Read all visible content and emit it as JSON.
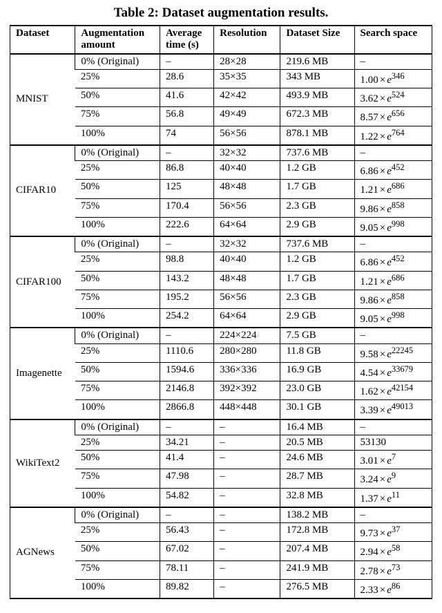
{
  "caption": "Table 2: Dataset augmentation results.",
  "columns": [
    "Dataset",
    "Augmentation amount",
    "Average time (s)",
    "Resolution",
    "Dataset Size",
    "Search space"
  ],
  "header_lines": {
    "col1": [
      "Augmentation",
      "amount"
    ],
    "col2": [
      "Average",
      "time (s)"
    ]
  },
  "groups": [
    {
      "name": "MNIST",
      "rows": [
        {
          "aug": "0% (Original)",
          "time": "–",
          "res": "28×28",
          "size": "219.6 MB",
          "search": {
            "text": "–"
          }
        },
        {
          "aug": "25%",
          "time": "28.6",
          "res": "35×35",
          "size": "343 MB",
          "search": {
            "coef": "1.00",
            "exp": "346"
          }
        },
        {
          "aug": "50%",
          "time": "41.6",
          "res": "42×42",
          "size": "493.9 MB",
          "search": {
            "coef": "3.62",
            "exp": "524"
          }
        },
        {
          "aug": "75%",
          "time": "56.8",
          "res": "49×49",
          "size": "672.3 MB",
          "search": {
            "coef": "8.57",
            "exp": "656"
          }
        },
        {
          "aug": "100%",
          "time": "74",
          "res": "56×56",
          "size": "878.1 MB",
          "search": {
            "coef": "1.22",
            "exp": "764"
          }
        }
      ]
    },
    {
      "name": "CIFAR10",
      "rows": [
        {
          "aug": "0% (Original)",
          "time": "–",
          "res": "32×32",
          "size": "737.6 MB",
          "search": {
            "text": "–"
          }
        },
        {
          "aug": "25%",
          "time": "86.8",
          "res": "40×40",
          "size": "1.2 GB",
          "search": {
            "coef": "6.86",
            "exp": "452"
          }
        },
        {
          "aug": "50%",
          "time": "125",
          "res": "48×48",
          "size": "1.7 GB",
          "search": {
            "coef": "1.21",
            "exp": "686"
          }
        },
        {
          "aug": "75%",
          "time": "170.4",
          "res": "56×56",
          "size": "2.3 GB",
          "search": {
            "coef": "9.86",
            "exp": "858"
          }
        },
        {
          "aug": "100%",
          "time": "222.6",
          "res": "64×64",
          "size": "2.9 GB",
          "search": {
            "coef": "9.05",
            "exp": "998"
          }
        }
      ]
    },
    {
      "name": "CIFAR100",
      "rows": [
        {
          "aug": "0% (Original)",
          "time": "–",
          "res": "32×32",
          "size": "737.6 MB",
          "search": {
            "text": "–"
          }
        },
        {
          "aug": "25%",
          "time": "98.8",
          "res": "40×40",
          "size": "1.2 GB",
          "search": {
            "coef": "6.86",
            "exp": "452"
          }
        },
        {
          "aug": "50%",
          "time": "143.2",
          "res": "48×48",
          "size": "1.7 GB",
          "search": {
            "coef": "1.21",
            "exp": "686"
          }
        },
        {
          "aug": "75%",
          "time": "195.2",
          "res": "56×56",
          "size": "2.3 GB",
          "search": {
            "coef": "9.86",
            "exp": "858"
          }
        },
        {
          "aug": "100%",
          "time": "254.2",
          "res": "64×64",
          "size": "2.9 GB",
          "search": {
            "coef": "9.05",
            "exp": "998"
          }
        }
      ]
    },
    {
      "name": "Imagenette",
      "rows": [
        {
          "aug": "0% (Original)",
          "time": "–",
          "res": "224×224",
          "size": "7.5 GB",
          "search": {
            "text": "–"
          }
        },
        {
          "aug": "25%",
          "time": "1110.6",
          "res": "280×280",
          "size": "11.8 GB",
          "search": {
            "coef": "9.58",
            "exp": "22245"
          }
        },
        {
          "aug": "50%",
          "time": "1594.6",
          "res": "336×336",
          "size": "16.9 GB",
          "search": {
            "coef": "4.54",
            "exp": "33679"
          }
        },
        {
          "aug": "75%",
          "time": "2146.8",
          "res": "392×392",
          "size": "23.0 GB",
          "search": {
            "coef": "1.62",
            "exp": "42154"
          }
        },
        {
          "aug": "100%",
          "time": "2866.8",
          "res": "448×448",
          "size": "30.1 GB",
          "search": {
            "coef": "3.39",
            "exp": "49013"
          }
        }
      ]
    },
    {
      "name": "WikiText2",
      "rows": [
        {
          "aug": "0% (Original)",
          "time": "–",
          "res": "–",
          "size": "16.4 MB",
          "search": {
            "text": "–"
          }
        },
        {
          "aug": "25%",
          "time": "34.21",
          "res": "–",
          "size": "20.5 MB",
          "search": {
            "text": "53130"
          }
        },
        {
          "aug": "50%",
          "time": "41.4",
          "res": "–",
          "size": "24.6 MB",
          "search": {
            "coef": "3.01",
            "exp": "7"
          }
        },
        {
          "aug": "75%",
          "time": "47.98",
          "res": "–",
          "size": "28.7 MB",
          "search": {
            "coef": "3.24",
            "exp": "9"
          }
        },
        {
          "aug": "100%",
          "time": "54.82",
          "res": "–",
          "size": "32.8 MB",
          "search": {
            "coef": "1.37",
            "exp": "11"
          }
        }
      ]
    },
    {
      "name": "AGNews",
      "rows": [
        {
          "aug": "0% (Original)",
          "time": "–",
          "res": "–",
          "size": "138.2 MB",
          "search": {
            "text": "–"
          }
        },
        {
          "aug": "25%",
          "time": "56.43",
          "res": "–",
          "size": "172.8 MB",
          "search": {
            "coef": "9.73",
            "exp": "37"
          }
        },
        {
          "aug": "50%",
          "time": "67.02",
          "res": "–",
          "size": "207.4 MB",
          "search": {
            "coef": "2.94",
            "exp": "58"
          }
        },
        {
          "aug": "75%",
          "time": "78.11",
          "res": "–",
          "size": "241.9 MB",
          "search": {
            "coef": "2.78",
            "exp": "73"
          }
        },
        {
          "aug": "100%",
          "time": "89.82",
          "res": "–",
          "size": "276.5 MB",
          "search": {
            "coef": "2.33",
            "exp": "86"
          }
        }
      ]
    }
  ]
}
